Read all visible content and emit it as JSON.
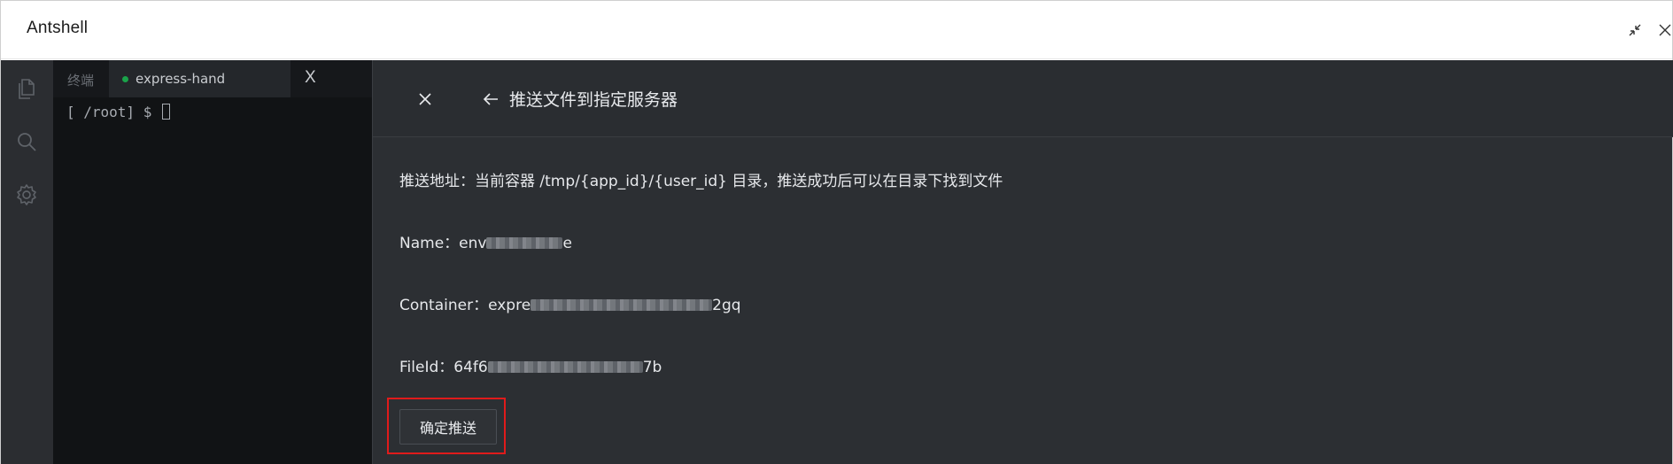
{
  "window": {
    "title": "Antshell"
  },
  "activity_bar": {
    "icons": [
      "files-icon",
      "search-icon",
      "gear-icon"
    ]
  },
  "terminal": {
    "tabs": [
      {
        "label": "终端",
        "active": false
      },
      {
        "label": "express-hand",
        "active": true,
        "status_color": "#1aa34a",
        "close_label": "X"
      }
    ],
    "prompt": "[ /root] $ "
  },
  "panel": {
    "title": "推送文件到指定服务器",
    "address_line": "推送地址：当前容器 /tmp/{app_id}/{user_id} 目录，推送成功后可以在目录下找到文件",
    "name": {
      "label": "Name：",
      "prefix": "env",
      "suffix": "e"
    },
    "container": {
      "label": "Container：",
      "prefix": "expre",
      "suffix": "2gq"
    },
    "fileid": {
      "label": "FileId：",
      "prefix": "64f6",
      "suffix": "7b"
    },
    "confirm_label": "确定推送"
  },
  "colors": {
    "panel_bg": "#2c2f33",
    "terminal_bg": "#111315",
    "highlight": "#e01b1b"
  }
}
